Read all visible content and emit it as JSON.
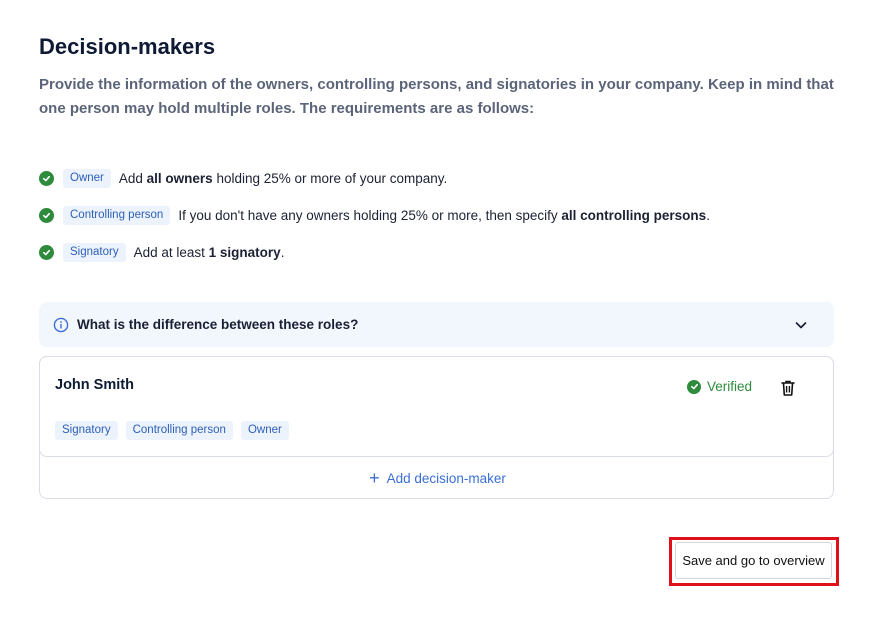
{
  "page": {
    "title": "Decision-makers",
    "intro": "Provide the information of the owners, controlling persons, and signatories in your company. Keep in mind that one person may hold multiple roles. The requirements are as follows:"
  },
  "requirements": [
    {
      "role": "Owner",
      "text_before": "Add ",
      "bold": "all owners",
      "text_after": " holding 25% or more of your company."
    },
    {
      "role": "Controlling person",
      "text_before": "If you don't have any owners holding 25% or more, then specify ",
      "bold": "all controlling persons",
      "text_after": "."
    },
    {
      "role": "Signatory",
      "text_before": "Add at least ",
      "bold": "1 signatory",
      "text_after": "."
    }
  ],
  "accordion": {
    "label": "What is the difference between these roles?"
  },
  "decision_makers": [
    {
      "name": "John Smith",
      "status": "Verified",
      "roles": [
        "Signatory",
        "Controlling person",
        "Owner"
      ]
    }
  ],
  "add_button": {
    "label": "Add decision-maker"
  },
  "save_button": {
    "label": "Save and go to overview"
  },
  "colors": {
    "accent": "#3b6fd6",
    "success": "#2e8b3c",
    "highlight": "#e0101a",
    "pill_bg": "#edf3fc"
  },
  "icons": {
    "check": "check-circle-icon",
    "info": "info-icon",
    "chevron": "chevron-down-icon",
    "trash": "trash-icon",
    "plus": "plus-icon"
  }
}
